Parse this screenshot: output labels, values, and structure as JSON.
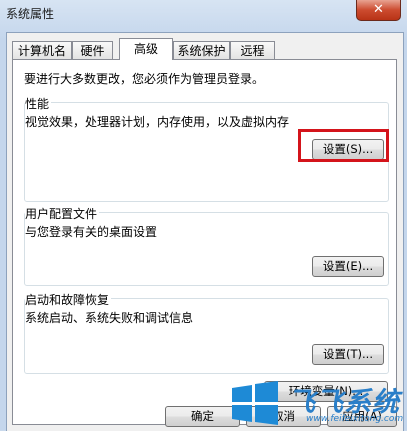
{
  "window": {
    "title": "系统属性",
    "close_label": "✕"
  },
  "tabs": [
    {
      "label": "计算机名"
    },
    {
      "label": "硬件"
    },
    {
      "label": "高级",
      "active": true
    },
    {
      "label": "系统保护"
    },
    {
      "label": "远程"
    }
  ],
  "admin_note": "要进行大多数更改，您必须作为管理员登录。",
  "performance": {
    "label": "性能",
    "description": "视觉效果，处理器计划，内存使用，以及虚拟内存",
    "button": "设置(S)..."
  },
  "user_profiles": {
    "label": "用户配置文件",
    "description": "与您登录有关的桌面设置",
    "button": "设置(E)..."
  },
  "startup_recovery": {
    "label": "启动和故障恢复",
    "description": "系统启动、系统失败和调试信息",
    "button": "设置(T)..."
  },
  "env_button": "环境变量(N)...",
  "footer": {
    "ok": "确定",
    "cancel": "取消",
    "apply": "应用(A)"
  },
  "watermark": {
    "text": "飞飞系统",
    "url": "www.feifeixitong.com"
  },
  "colors": {
    "highlight": "#d4141b",
    "close": "#cc4b2f",
    "watermark": "#2a7fc9"
  }
}
